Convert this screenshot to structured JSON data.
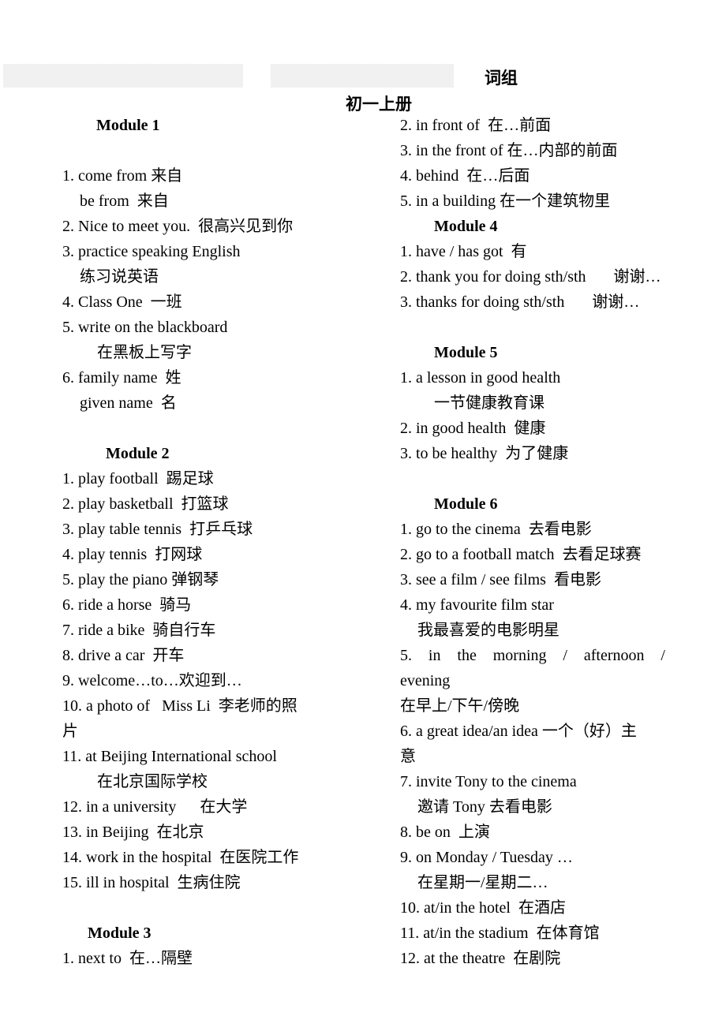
{
  "header": {
    "title": "词组",
    "subtitle": "初一上册"
  },
  "left_column": [
    {
      "kind": "heading",
      "text": "Module 1"
    },
    {
      "kind": "blank",
      "text": ""
    },
    {
      "kind": "item",
      "text": "1. come from 来自"
    },
    {
      "kind": "continuation",
      "text": "be from  来自"
    },
    {
      "kind": "item",
      "text": "2. Nice to meet you.  很高兴见到你"
    },
    {
      "kind": "item",
      "text": "3. practice speaking English"
    },
    {
      "kind": "continuation",
      "text": "练习说英语"
    },
    {
      "kind": "item",
      "text": "4. Class One  一班"
    },
    {
      "kind": "item",
      "text": "5. write on the blackboard"
    },
    {
      "kind": "translation",
      "text": "在黑板上写字"
    },
    {
      "kind": "item",
      "text": "6. family name  姓"
    },
    {
      "kind": "continuation",
      "text": "given name  名"
    },
    {
      "kind": "blank",
      "text": ""
    },
    {
      "kind": "heading",
      "text": "Module 2"
    },
    {
      "kind": "item",
      "text": "1. play football  踢足球"
    },
    {
      "kind": "item",
      "text": "2. play basketball  打篮球"
    },
    {
      "kind": "item",
      "text": "3. play table tennis  打乒乓球"
    },
    {
      "kind": "item",
      "text": "4. play tennis  打网球"
    },
    {
      "kind": "item",
      "text": "5. play the piano 弹钢琴"
    },
    {
      "kind": "item",
      "text": "6. ride a horse  骑马"
    },
    {
      "kind": "item",
      "text": "7. ride a bike  骑自行车"
    },
    {
      "kind": "item",
      "text": "8. drive a car  开车"
    },
    {
      "kind": "item",
      "text": "9. welcome…to…欢迎到…"
    },
    {
      "kind": "item",
      "text": "10. a photo of   Miss Li  李老师的照"
    },
    {
      "kind": "item",
      "text": "片"
    },
    {
      "kind": "item",
      "text": "11. at Beijing International school"
    },
    {
      "kind": "translation",
      "text": "在北京国际学校"
    },
    {
      "kind": "item",
      "text": "12. in a university      在大学"
    },
    {
      "kind": "item",
      "text": "13. in Beijing  在北京"
    },
    {
      "kind": "item",
      "text": "14. work in the hospital  在医院工作"
    },
    {
      "kind": "item",
      "text": "15. ill in hospital  生病住院"
    },
    {
      "kind": "blank",
      "text": ""
    },
    {
      "kind": "heading",
      "text": "Module 3"
    },
    {
      "kind": "item",
      "text": "1. next to  在…隔壁"
    }
  ],
  "right_column": [
    {
      "kind": "item",
      "text": "2. in front of  在…前面"
    },
    {
      "kind": "item",
      "text": "3. in the front of 在…内部的前面"
    },
    {
      "kind": "item",
      "text": "4. behind  在…后面"
    },
    {
      "kind": "item",
      "text": "5. in a building 在一个建筑物里"
    },
    {
      "kind": "heading",
      "text": "Module 4"
    },
    {
      "kind": "item",
      "text": "1. have / has got  有"
    },
    {
      "kind": "item",
      "text": "2. thank you for doing sth/sth       谢谢…"
    },
    {
      "kind": "item",
      "text": "3. thanks for doing sth/sth       谢谢…"
    },
    {
      "kind": "blank",
      "text": ""
    },
    {
      "kind": "heading",
      "text": "Module 5"
    },
    {
      "kind": "item",
      "text": "1. a lesson in good health"
    },
    {
      "kind": "translation",
      "text": "一节健康教育课"
    },
    {
      "kind": "item",
      "text": "2. in good health  健康"
    },
    {
      "kind": "item",
      "text": "3. to be healthy  为了健康"
    },
    {
      "kind": "blank",
      "text": ""
    },
    {
      "kind": "heading",
      "text": "Module 6"
    },
    {
      "kind": "item",
      "text": "1. go to the cinema  去看电影"
    },
    {
      "kind": "item",
      "text": "2. go to a football match  去看足球赛"
    },
    {
      "kind": "item",
      "text": "3. see a film / see films  看电影"
    },
    {
      "kind": "item",
      "text": "4. my favourite film star"
    },
    {
      "kind": "continuation",
      "text": "我最喜爱的电影明星"
    },
    {
      "kind": "justified",
      "text": "5. in the morning / afternoon /"
    },
    {
      "kind": "item",
      "text": "evening"
    },
    {
      "kind": "item",
      "text": "在早上/下午/傍晚"
    },
    {
      "kind": "item",
      "text": "6. a great idea/an idea 一个（好）主"
    },
    {
      "kind": "item",
      "text": "意"
    },
    {
      "kind": "item",
      "text": "7. invite Tony to the cinema"
    },
    {
      "kind": "continuation",
      "text": "邀请 Tony 去看电影"
    },
    {
      "kind": "item",
      "text": "8. be on  上演"
    },
    {
      "kind": "item",
      "text": "9. on Monday / Tuesday …"
    },
    {
      "kind": "continuation",
      "text": "在星期一/星期二…"
    },
    {
      "kind": "item",
      "text": "10. at/in the hotel  在酒店"
    },
    {
      "kind": "item",
      "text": "11. at/in the stadium  在体育馆"
    },
    {
      "kind": "item",
      "text": "12. at the theatre  在剧院"
    }
  ]
}
